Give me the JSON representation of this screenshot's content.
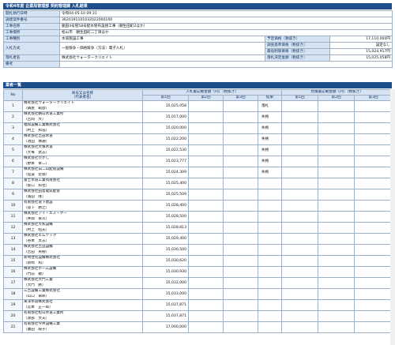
{
  "title": "令和4年度 企業局管理部 契約管理課 入札結果",
  "info": {
    "rows": [
      {
        "label": "開札執行日時",
        "value": "令和04-05-10 09:31"
      },
      {
        "label": "調達案件番号",
        "value": "3620191101032022000100"
      },
      {
        "label": "工事名称",
        "value": "脇田4号管58号配水管布設替工事（朝生田町2ほか）"
      },
      {
        "label": "工事場所",
        "value": "松山市　朝生田町二丁目ほか"
      }
    ],
    "kind_label": "工事種別",
    "kind_value": "水道施設工事",
    "method_label": "入札方式",
    "method_value": "一般競争・価格競争（方法：電子入札）",
    "winner_label": "落札者名",
    "winner_value": "株式会社ウォータークリエイト",
    "note_label": "備考",
    "note_value": "",
    "prices": [
      {
        "label": "予定価格（税抜き）",
        "value": "17,110,000円"
      },
      {
        "label": "調査基準価格（税抜き）",
        "value": "設定なし"
      },
      {
        "label": "最低制限価格（税抜き）",
        "value": "15,024,917円"
      },
      {
        "label": "落札決定金額（税抜き）",
        "value": "15,025,058円"
      }
    ]
  },
  "section_title": "業者一覧",
  "table": {
    "headers": {
      "no": "No",
      "name": "商号又は名称\n（代表者名）",
      "bid_group": "入札書記載金額（円）（税抜き）",
      "quote_group": "見積書記載金額（円）（税抜き）",
      "round1": "第1回",
      "round2": "第2回",
      "round3": "第3回",
      "result": "結果"
    },
    "rows": [
      {
        "no": "1",
        "company": "株式会社ウォータークリエイト",
        "rep": "（鍋屋　範彦）",
        "amount": "15,025,058",
        "result": "落札"
      },
      {
        "no": "2",
        "company": "株式会社鶴山水道工業所",
        "rep": "（吉岡　大）",
        "amount": "15,017,000",
        "result": "失格"
      },
      {
        "no": "3",
        "company": "福和設備工業株式会社",
        "rep": "（村上　和浩）",
        "amount": "15,020,000",
        "result": "失格"
      },
      {
        "no": "4",
        "company": "株式会社吉田水道",
        "rep": "（池田　博通）",
        "amount": "15,022,200",
        "result": "失格"
      },
      {
        "no": "5",
        "company": "株式会社大塚水道",
        "rep": "（大塚　武志）",
        "amount": "15,022,530",
        "result": "失格"
      },
      {
        "no": "6",
        "company": "株式会社かがし",
        "rep": "（野本　幸二）",
        "amount": "15,023,777",
        "result": "失格"
      },
      {
        "no": "7",
        "company": "株式会社白二山配管設備",
        "rep": "（仙波　宏徳）",
        "amount": "15,024,309",
        "result": "失格"
      },
      {
        "no": "8",
        "company": "富士水道工業有限会社",
        "rep": "（坂口　和也）",
        "amount": "15,025,400",
        "result": ""
      },
      {
        "no": "9",
        "company": "株式会社田島電気配管",
        "rep": "（濱田　隆）",
        "amount": "15,025,509",
        "result": ""
      },
      {
        "no": "10",
        "company": "有限会社道下建設",
        "rep": "（道下　勝之）",
        "amount": "15,028,400",
        "result": ""
      },
      {
        "no": "11",
        "company": "株式会社アイ・エス・ケー",
        "rep": "（井関　幸次）",
        "amount": "15,028,500",
        "result": ""
      },
      {
        "no": "12",
        "company": "株式会社大和設備",
        "rep": "（村上　昭夫）",
        "amount": "15,028,813",
        "result": ""
      },
      {
        "no": "13",
        "company": "株式会社エムテック",
        "rep": "（谷本　太志）",
        "amount": "15,029,400",
        "result": ""
      },
      {
        "no": "14",
        "company": "株式会社吉田設備",
        "rep": "（吉田　英樹）",
        "amount": "15,030,500",
        "result": ""
      },
      {
        "no": "15",
        "company": "新崎住宅設備株式会社",
        "rep": "（新崎　和）",
        "amount": "15,030,620",
        "result": ""
      },
      {
        "no": "16",
        "company": "株式会社ホーム設備",
        "rep": "（門前　勲）",
        "amount": "15,030,930",
        "result": ""
      },
      {
        "no": "17",
        "company": "株式会社大門工業",
        "rep": "（大門　勝）",
        "amount": "15,032,000",
        "result": ""
      },
      {
        "no": "18",
        "company": "三吉設備工業株式会社",
        "rep": "（山口　卓郎）",
        "amount": "15,033,000",
        "result": ""
      },
      {
        "no": "19",
        "company": "東洋水道株式会社",
        "rep": "（宮本　正一郎）",
        "amount": "15,037,871",
        "result": ""
      },
      {
        "no": "20",
        "company": "有限会社松山水道工業所",
        "rep": "（渡部　文夫）",
        "amount": "15,037,871",
        "result": ""
      },
      {
        "no": "21",
        "company": "有限会社今井設備工業",
        "rep": "（廣田　陽子）",
        "amount": "17,000,000",
        "result": ""
      }
    ]
  }
}
